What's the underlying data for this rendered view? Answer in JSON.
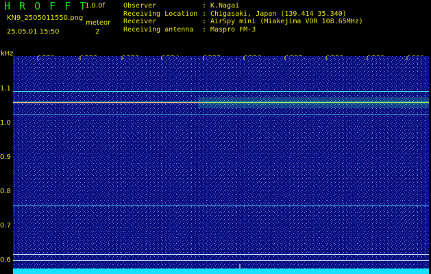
{
  "header": {
    "app_title": "H R O F F T",
    "version": "1.0.0f",
    "filename": "KN9_2505011550.png",
    "mode": "meteor",
    "timestamp": "25.05.01 15:50",
    "count": "2"
  },
  "station": {
    "rows": [
      {
        "label": "Observer",
        "value": "K.Nagai"
      },
      {
        "label": "Receiving Location",
        "value": "Chigasaki, Japan (139.414 35.340)"
      },
      {
        "label": "Receiver",
        "value": "AirSpy mini (Miakejima VOR 108.65MHz)"
      },
      {
        "label": "Receiving antenna",
        "value": "Maspro FM-3"
      }
    ],
    "separator": ":"
  },
  "axes": {
    "y_unit": "kHz",
    "y_ticks": [
      "1.1",
      "1.0",
      "0.9",
      "0.8",
      "0.7",
      "0.6"
    ],
    "time_ticks": [
      "1551",
      "1552",
      "1553",
      "1554",
      "1555",
      "1556",
      "1557",
      "1558",
      "1559",
      "1600"
    ]
  },
  "colors": {
    "background": "#000000",
    "plot_noise": "#0a0a7a",
    "text": "#e8e800",
    "title": "#18e018",
    "line": "#40e0ff"
  }
}
